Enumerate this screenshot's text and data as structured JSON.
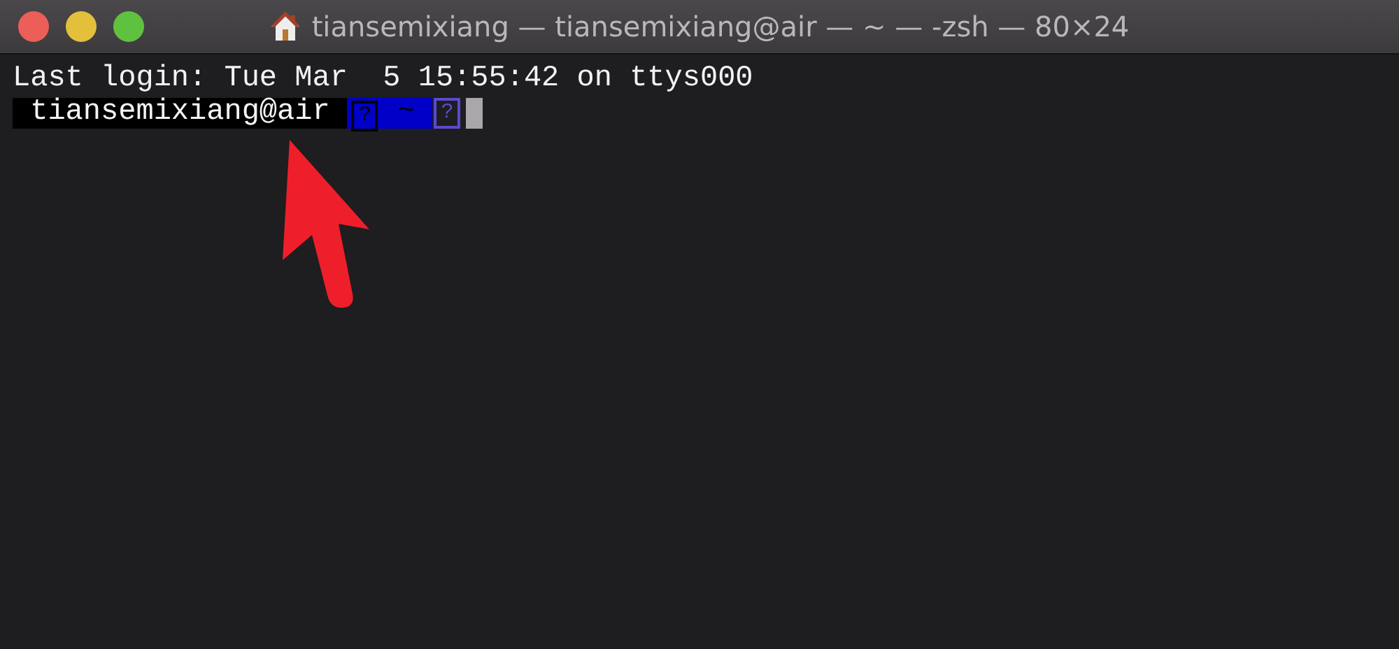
{
  "window": {
    "title": "tiansemixiang — tiansemixiang@air — ~ — -zsh — 80×24"
  },
  "terminal": {
    "lines": [
      "Last login: Tue Mar  5 15:55:42 on ttys000"
    ],
    "prompt": [
      {
        "kind": "user",
        "text": " tiansemixiang@air "
      },
      {
        "kind": "dir",
        "text": "?"
      },
      {
        "kind": "dir",
        "text": " ~ "
      },
      {
        "kind": "glyph",
        "text": "?"
      }
    ],
    "cursor": {
      "kind": "block"
    }
  }
}
